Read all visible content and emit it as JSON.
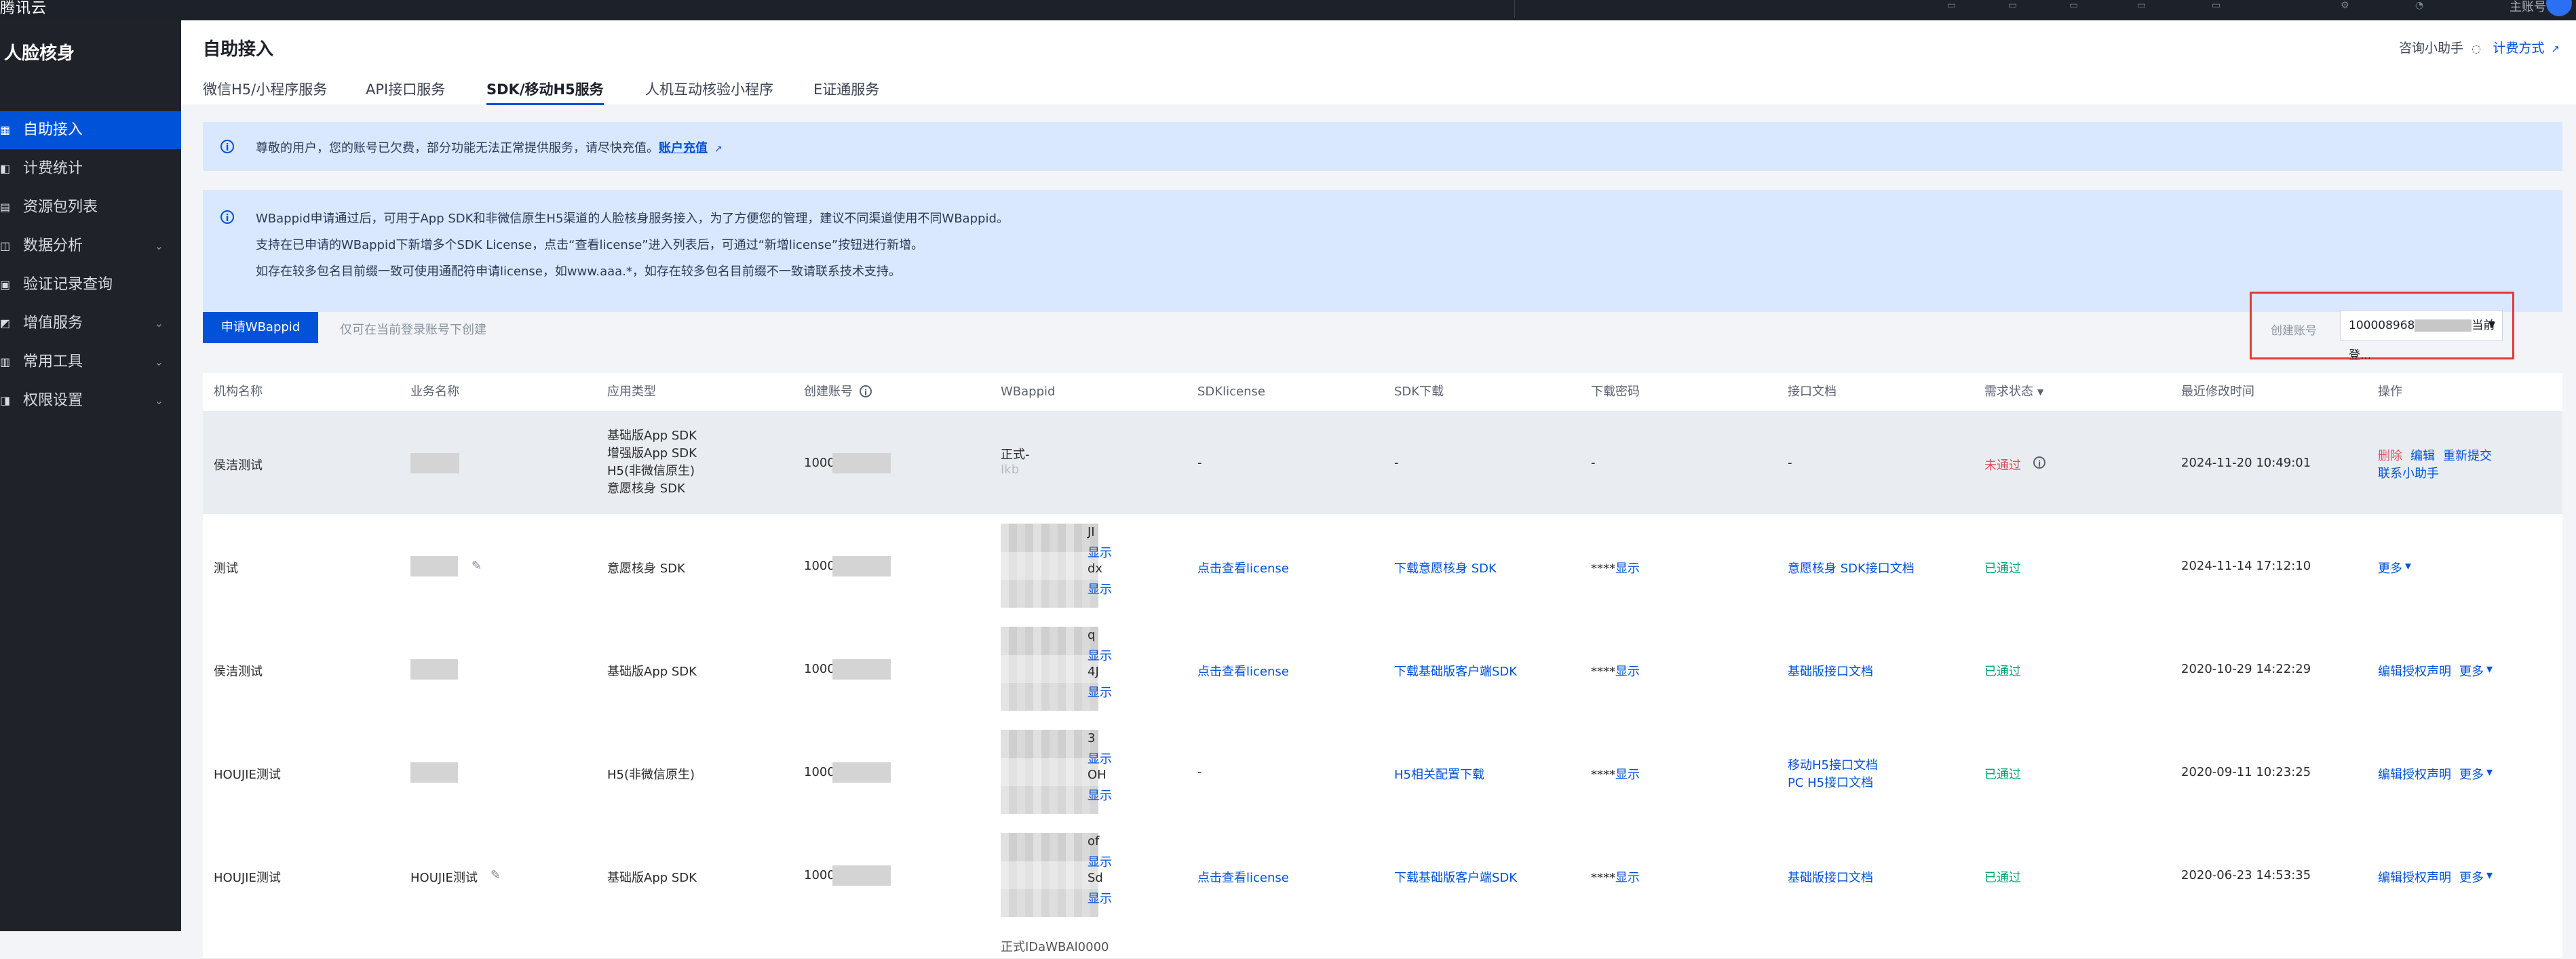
{
  "topbar": {
    "brand": "腾讯云",
    "account": "主账号"
  },
  "sidebar": {
    "title": "人脸核身",
    "items": [
      {
        "label": "自助接入",
        "active": true,
        "chevron": false
      },
      {
        "label": "计费统计",
        "active": false,
        "chevron": false
      },
      {
        "label": "资源包列表",
        "active": false,
        "chevron": false
      },
      {
        "label": "数据分析",
        "active": false,
        "chevron": true
      },
      {
        "label": "验证记录查询",
        "active": false,
        "chevron": false
      },
      {
        "label": "增值服务",
        "active": false,
        "chevron": true
      },
      {
        "label": "常用工具",
        "active": false,
        "chevron": true
      },
      {
        "label": "权限设置",
        "active": false,
        "chevron": true
      }
    ]
  },
  "header": {
    "title": "自助接入",
    "helper": "咨询小助手",
    "billing": "计费方式"
  },
  "tabs": [
    {
      "label": "微信H5/小程序服务",
      "active": false
    },
    {
      "label": "API接口服务",
      "active": false
    },
    {
      "label": "SDK/移动H5服务",
      "active": true
    },
    {
      "label": "人机互动核验小程序",
      "active": false
    },
    {
      "label": "E证通服务",
      "active": false
    }
  ],
  "notice_arrears": {
    "text": "尊敬的用户，您的账号已欠费，部分功能无法正常提供服务，请尽快充值。",
    "link": "账户充值"
  },
  "notice_wbappid": {
    "line1": "WBappid申请通过后，可用于App SDK和非微信原生H5渠道的人脸核身服务接入，为了方便您的管理，建议不同渠道使用不同WBappid。",
    "line2": "支持在已申请的WBappid下新增多个SDK License，点击“查看license”进入列表后，可通过“新增license”按钮进行新增。",
    "line3": "如存在较多包名目前缀一致可使用通配符申请license，如www.aaa.*，如存在较多包名目前缀不一致请联系技术支持。"
  },
  "toolbar": {
    "apply_button": "申请WBappid",
    "hint": "仅可在当前登录账号下创建"
  },
  "account_filter": {
    "label": "创建账号",
    "value_prefix": "100008968",
    "value_suffix": "当前登..."
  },
  "table": {
    "columns": [
      "机构名称",
      "业务名称",
      "应用类型",
      "创建账号",
      "WBappid",
      "SDKlicense",
      "SDK下载",
      "下载密码",
      "接口文档",
      "需求状态",
      "最近修改时间",
      "操作"
    ],
    "rows": [
      {
        "org": "侯洁测试",
        "biz": "",
        "app_types": [
          "基础版App SDK",
          "增强版App SDK",
          "H5(非微信原生)",
          "意愿核身 SDK"
        ],
        "account": "1000",
        "wbappid": [
          "正式-",
          "Ikb"
        ],
        "license": "-",
        "sdk_download": "-",
        "password": "-",
        "docs": [
          "-"
        ],
        "status": "未通过",
        "status_ok": false,
        "time": "2024-11-20 10:49:01",
        "actions": [
          "删除",
          "编辑",
          "重新提交",
          "联系小助手"
        ]
      },
      {
        "org": "测试",
        "biz": "",
        "app_types": [
          "意愿核身 SDK"
        ],
        "account": "1000",
        "wbappid": [
          "JI",
          "显示",
          "dx",
          "显示"
        ],
        "license": "点击查看license",
        "sdk_download": "下载意愿核身 SDK",
        "password": "****显示",
        "docs": [
          "意愿核身 SDK接口文档"
        ],
        "status": "已通过",
        "status_ok": true,
        "time": "2024-11-14 17:12:10",
        "actions": [
          "更多"
        ]
      },
      {
        "org": "侯洁测试",
        "biz": "",
        "app_types": [
          "基础版App SDK"
        ],
        "account": "1000",
        "wbappid": [
          "q",
          "显示",
          "4J",
          "显示"
        ],
        "license": "点击查看license",
        "sdk_download": "下载基础版客户端SDK",
        "password": "****显示",
        "docs": [
          "基础版接口文档"
        ],
        "status": "已通过",
        "status_ok": true,
        "time": "2020-10-29 14:22:29",
        "actions": [
          "编辑授权声明",
          "更多"
        ]
      },
      {
        "org": "HOUJIE测试",
        "biz": "",
        "app_types": [
          "H5(非微信原生)"
        ],
        "account": "1000",
        "wbappid": [
          "3",
          "显示",
          "OH",
          "显示"
        ],
        "license": "-",
        "sdk_download": "H5相关配置下载",
        "password": "****显示",
        "docs": [
          "移动H5接口文档",
          "PC H5接口文档"
        ],
        "status": "已通过",
        "status_ok": true,
        "time": "2020-09-11 10:23:25",
        "actions": [
          "编辑授权声明",
          "更多"
        ]
      },
      {
        "org": "HOUJIE测试",
        "biz": "HOUJIE测试",
        "app_types": [
          "基础版App SDK"
        ],
        "account": "1000",
        "wbappid": [
          "of",
          "显示",
          "Sd",
          "显示"
        ],
        "license": "点击查看license",
        "sdk_download": "下载基础版客户端SDK",
        "password": "****显示",
        "docs": [
          "基础版接口文档"
        ],
        "status": "已通过",
        "status_ok": true,
        "time": "2020-06-23 14:53:35",
        "actions": [
          "编辑授权声明",
          "更多"
        ]
      }
    ],
    "partial_row_text": "正式IDaWBAl0000"
  },
  "colors": {
    "primary": "#0052d9",
    "sidebar_bg": "#1f2329",
    "notice_bg": "#d9e8ff",
    "success": "#00a870",
    "danger": "#e34d59",
    "annotation": "#e53935"
  }
}
